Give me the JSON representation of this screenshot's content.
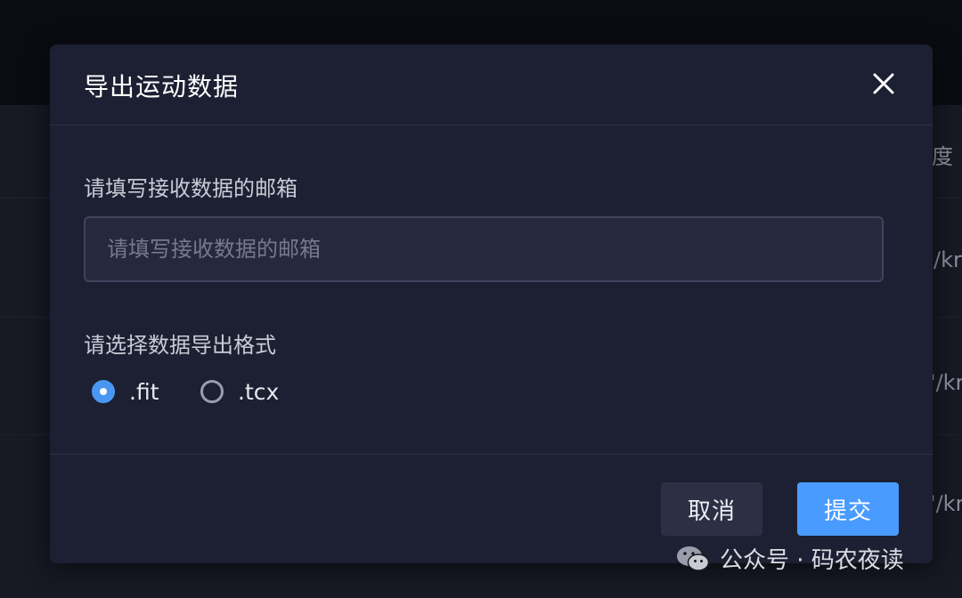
{
  "background": {
    "peek_texts": [
      "度",
      "/kr",
      "'/kr",
      "'/kr"
    ]
  },
  "dialog": {
    "title": "导出运动数据",
    "close_icon": "close-icon",
    "email": {
      "label": "请填写接收数据的邮箱",
      "placeholder": "请填写接收数据的邮箱",
      "value": ""
    },
    "format": {
      "label": "请选择数据导出格式",
      "options": [
        {
          "label": ".fit",
          "selected": true
        },
        {
          "label": ".tcx",
          "selected": false
        }
      ]
    },
    "buttons": {
      "cancel": "取消",
      "submit": "提交"
    }
  },
  "watermark": {
    "icon": "wechat-icon",
    "text": "公众号 · 码农夜读"
  },
  "colors": {
    "accent": "#4a9bff",
    "dialog_bg": "#1d2033",
    "page_bg": "#171923"
  }
}
